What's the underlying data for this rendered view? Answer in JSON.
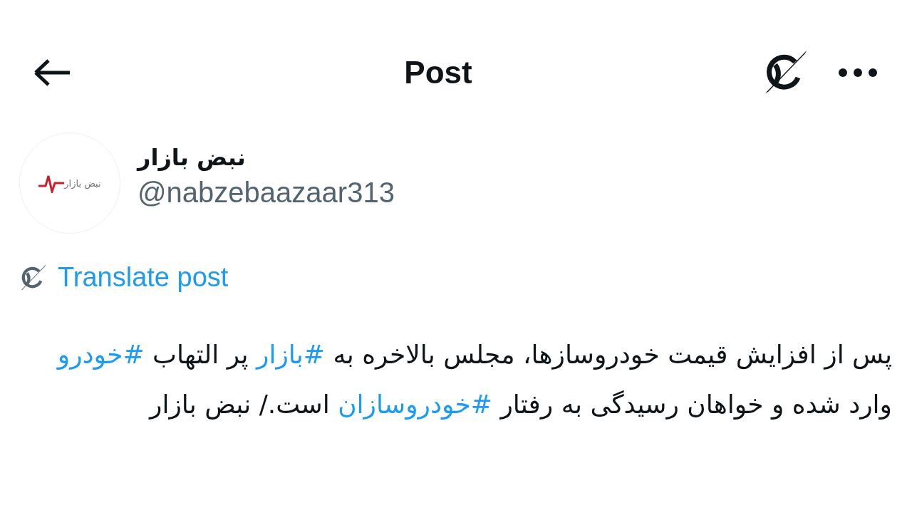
{
  "header": {
    "title": "Post"
  },
  "author": {
    "logo_text": "نبض بازار",
    "name": "نبض بازار",
    "handle": "@nabzebaazaar313"
  },
  "translate": {
    "label": "Translate post"
  },
  "body": [
    {
      "kind": "text",
      "text": "پس از افزایش قیمت خودروسازها، مجلس بالاخره به "
    },
    {
      "kind": "hashtag",
      "text": "#بازار"
    },
    {
      "kind": "text",
      "text": " پر التهاب "
    },
    {
      "kind": "hashtag",
      "text": "#خودرو"
    },
    {
      "kind": "text",
      "text": " وارد شده و خواهان رسیدگی به رفتار "
    },
    {
      "kind": "hashtag",
      "text": "#خودروسازان"
    },
    {
      "kind": "text",
      "text": " است./ نبض بازار"
    }
  ]
}
